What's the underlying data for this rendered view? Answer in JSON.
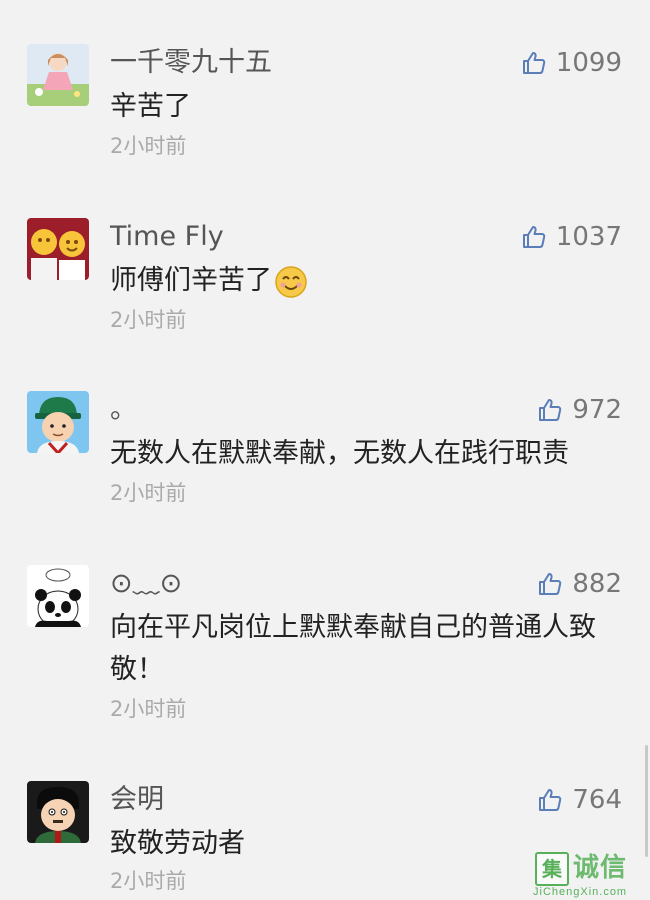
{
  "comments": [
    {
      "name": "一千零九十五",
      "text": "辛苦了",
      "time": "2小时前",
      "likes": "1099"
    },
    {
      "name": "Time Fly",
      "text": "师傅们辛苦了",
      "time": "2小时前",
      "likes": "1037",
      "emoji": "smile-emoji"
    },
    {
      "name": "。",
      "text": "无数人在默默奉献，无数人在践行职责",
      "time": "2小时前",
      "likes": "972"
    },
    {
      "name": "⊙﹏⊙",
      "text": "向在平凡岗位上默默奉献自己的普通人致敬！",
      "time": "2小时前",
      "likes": "882"
    },
    {
      "name": "会明",
      "text": "致敬劳动者",
      "time": "2小时前",
      "likes": "764"
    }
  ],
  "icons": {
    "like": "thumbs-up-icon"
  },
  "colors": {
    "like_icon": "#5b7db8",
    "name": "#555555",
    "text": "#222222",
    "time": "#aaaaaa"
  },
  "watermark": {
    "box": "集",
    "brand": "诚信",
    "url": "JiChengXin.com"
  }
}
